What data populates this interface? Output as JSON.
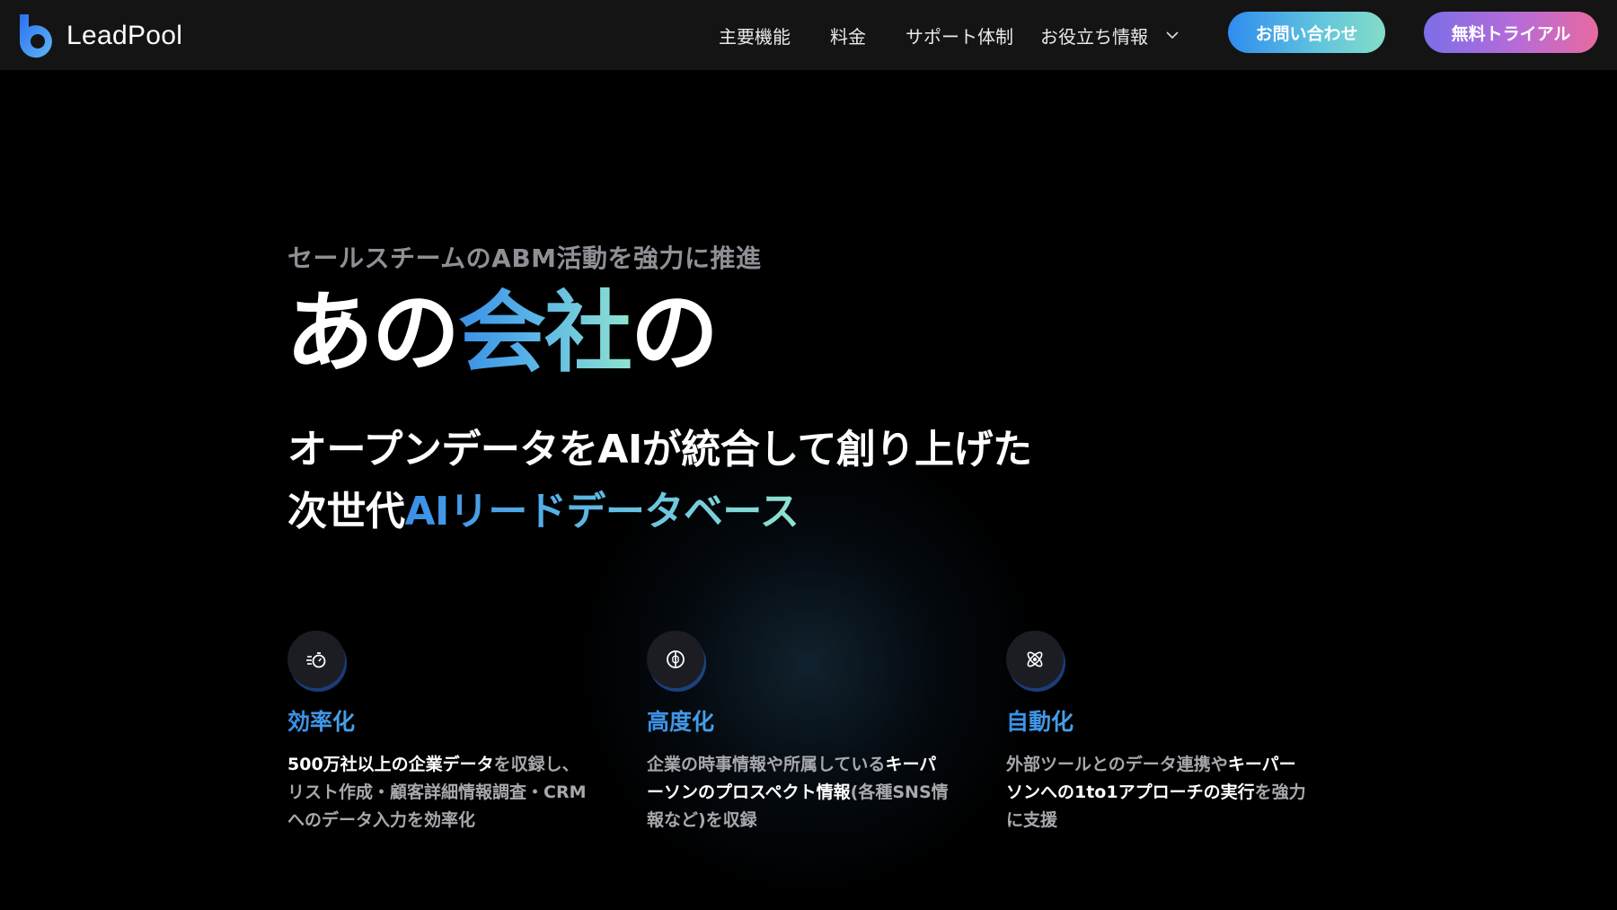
{
  "header": {
    "brand": "LeadPool",
    "nav": [
      "主要機能",
      "料金",
      "サポート体制",
      "お役立ち情報"
    ],
    "contact_label": "お問い合わせ",
    "trial_label": "無料トライアル"
  },
  "hero": {
    "eyebrow": "セールスチームのABM活動を強力に推進",
    "headline_a": "あの",
    "headline_b": "会社",
    "headline_c": "の",
    "sub1": "オープンデータをAIが統合して創り上げた",
    "sub2_a": "次世代",
    "sub2_b": "AIリードデータベース"
  },
  "features": [
    {
      "icon": "stopwatch-icon",
      "title": "効率化",
      "desc_line1_hl": "500万社以上の企業データ",
      "desc_line1_rest": "を収録し、",
      "desc_line2": "リスト作成・顧客詳細情報調査・CRM",
      "desc_line3": "へのデータ入力を効率化"
    },
    {
      "icon": "brain-icon",
      "title": "高度化",
      "desc_line1": "企業の時事情報や所属している",
      "desc_line1_hl": "キーパ",
      "desc_line2_hl": "ーソンのプロスペクト情報",
      "desc_line2_rest": "(各種SNS情",
      "desc_line3": "報など)を収録"
    },
    {
      "icon": "atom-icon",
      "title": "自動化",
      "desc_line1": "外部ツールとのデータ連携や",
      "desc_line1_hl": "キーパー",
      "desc_line2_hl": "ソンへの1to1アプローチの実行",
      "desc_line2_rest": "を強力",
      "desc_line3": "に支援"
    }
  ],
  "colors": {
    "header_bg": "#141414",
    "accent_blue": "#3a8fe6",
    "accent_mint": "#8fe3cf",
    "trial_start": "#7b6fe8",
    "trial_end": "#e86aa0"
  }
}
